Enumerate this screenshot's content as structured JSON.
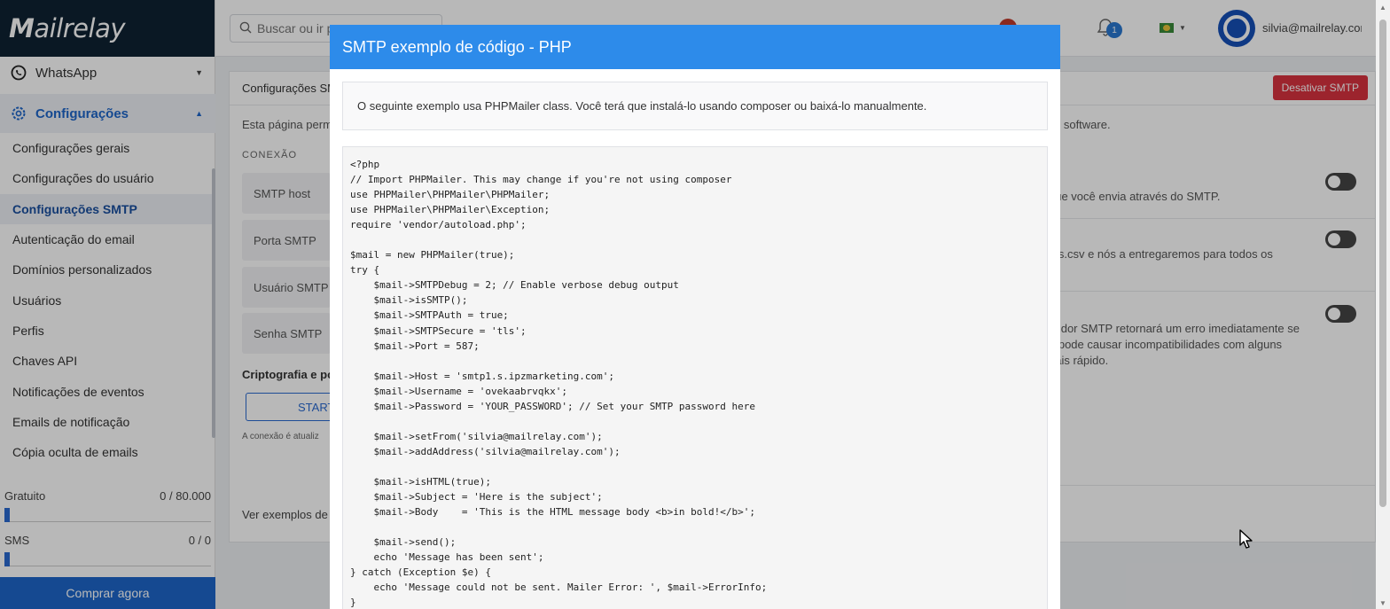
{
  "brand": {
    "logo_text_bold": "M",
    "logo_text": "ailrelay"
  },
  "sidebar": {
    "whatsapp_label": "WhatsApp",
    "config_label": "Configurações",
    "items": [
      "Configurações gerais",
      "Configurações do usuário",
      "Configurações SMTP",
      "Autenticação do email",
      "Domínios personalizados",
      "Usuários",
      "Perfis",
      "Chaves API",
      "Notificações de eventos",
      "Emails de notificação",
      "Cópia oculta de emails"
    ],
    "active_index": 2,
    "plan_free_label": "Gratuito",
    "plan_free_value": "0 / 80.000",
    "plan_sms_label": "SMS",
    "plan_sms_value": "0 / 0",
    "buy_label": "Comprar agora"
  },
  "topbar": {
    "search_placeholder": "Buscar ou ir para...",
    "notification_count": "1",
    "user_email": "silvia@mailrelay.com"
  },
  "page": {
    "header_title": "Configurações SMTP",
    "deactivate_label": "Desativar SMTP",
    "description_left": "Esta página permite",
    "description_right": "o software.",
    "section_connection": "CONEXÃO",
    "fields": [
      "SMTP host",
      "Porta SMTP",
      "Usuário SMTP",
      "Senha SMTP"
    ],
    "crypto_label": "Criptografia e po",
    "starttls_label": "START",
    "connection_note": "A conexão é atualiz",
    "examples_label": "Ver exemplos de",
    "right_text_1": "que você envia através do SMTP.",
    "right_text_2": "nts.csv e nós a entregaremos para todos os",
    "right_text_3a": "rvidor SMTP retornará um erro imediatamente se",
    "right_text_3b": "o pode causar incompatibilidades com alguns",
    "right_text_3c": "nais rápido."
  },
  "modal": {
    "title": "SMTP exemplo de código - PHP",
    "info": "O seguinte exemplo usa PHPMailer class. Você terá que instalá-lo usando composer ou baixá-lo manualmente.",
    "code": "<?php\n// Import PHPMailer. This may change if you're not using composer\nuse PHPMailer\\PHPMailer\\PHPMailer;\nuse PHPMailer\\PHPMailer\\Exception;\nrequire 'vendor/autoload.php';\n\n$mail = new PHPMailer(true);\ntry {\n    $mail->SMTPDebug = 2; // Enable verbose debug output\n    $mail->isSMTP();\n    $mail->SMTPAuth = true;\n    $mail->SMTPSecure = 'tls';\n    $mail->Port = 587;\n\n    $mail->Host = 'smtp1.s.ipzmarketing.com';\n    $mail->Username = 'ovekaabrvqkx';\n    $mail->Password = 'YOUR_PASSWORD'; // Set your SMTP password here\n\n    $mail->setFrom('silvia@mailrelay.com');\n    $mail->addAddress('silvia@mailrelay.com');\n\n    $mail->isHTML(true);\n    $mail->Subject = 'Here is the subject';\n    $mail->Body    = 'This is the HTML message body <b>in bold!</b>';\n\n    $mail->send();\n    echo 'Message has been sent';\n} catch (Exception $e) {\n    echo 'Message could not be sent. Mailer Error: ', $mail->ErrorInfo;\n}"
  },
  "colors": {
    "accent": "#2d8bea",
    "brand_dark": "#0e2233",
    "primary": "#1e66c9",
    "danger": "#d9333f"
  }
}
